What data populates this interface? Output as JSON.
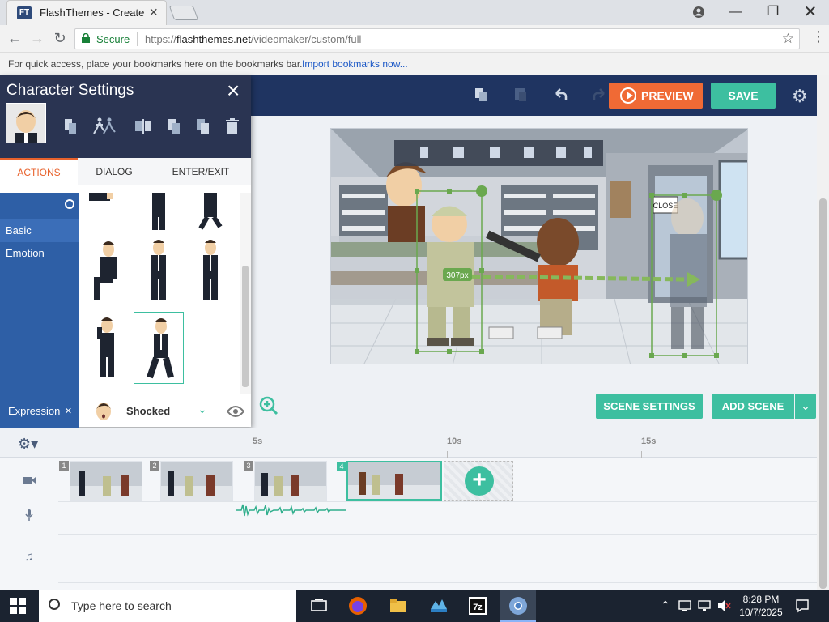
{
  "browser": {
    "tab_title": "FlashThemes - Create",
    "favicon_text": "FT",
    "secure_label": "Secure",
    "url_scheme": "https://",
    "url_host": "flashthemes.net",
    "url_path": "/videomaker/custom/full",
    "bookmarks_hint": "For quick access, place your bookmarks here on the bookmarks bar.",
    "bookmarks_link": "Import bookmarks now..."
  },
  "toolbar": {
    "preview_label": "PREVIEW",
    "save_label": "SAVE"
  },
  "character_settings": {
    "title": "Character Settings",
    "tabs": [
      "ACTIONS",
      "DIALOG",
      "ENTER/EXIT"
    ],
    "active_tab": "ACTIONS",
    "categories": [
      "Basic",
      "Emotion"
    ],
    "selected_category": "Basic",
    "expression_label": "Expression",
    "expression_value": "Shocked"
  },
  "stage": {
    "motion_distance": "307px",
    "sign_text": "CLOSE"
  },
  "buttons": {
    "scene_settings": "SCENE SETTINGS",
    "add_scene": "ADD SCENE"
  },
  "timeline": {
    "ticks": [
      "5s",
      "10s",
      "15s"
    ],
    "scenes": [
      "1",
      "2",
      "3",
      "4"
    ],
    "selected_scene": "4"
  },
  "taskbar": {
    "search_placeholder": "Type here to search",
    "time": "8:28 PM",
    "date": "10/7/2025"
  },
  "colors": {
    "accent_orange": "#f06a35",
    "accent_green": "#3dbfa0",
    "header_navy": "#1f3461",
    "panel_blue": "#2e5fa6"
  }
}
